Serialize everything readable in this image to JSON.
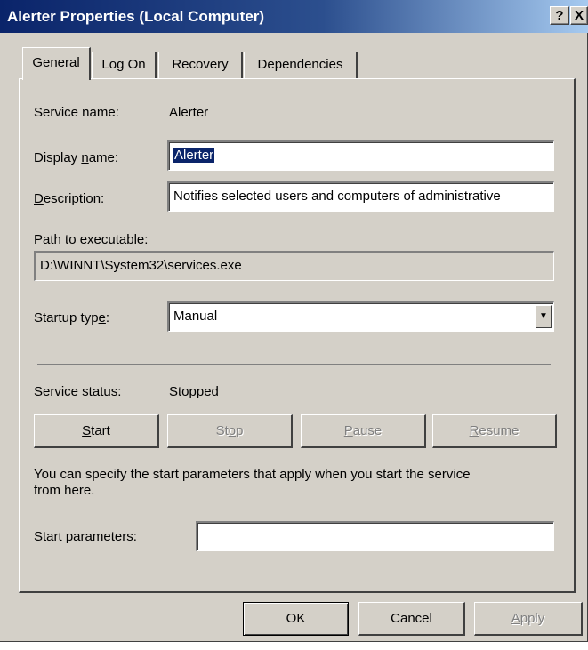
{
  "window": {
    "title": "Alerter Properties (Local Computer)",
    "help_label": "?",
    "close_label": "X"
  },
  "tabs": [
    {
      "label": "General",
      "active": true
    },
    {
      "label": "Log On",
      "active": false
    },
    {
      "label": "Recovery",
      "active": false
    },
    {
      "label": "Dependencies",
      "active": false
    }
  ],
  "general": {
    "service_name_label": "Service name:",
    "service_name_value": "Alerter",
    "display_name_label_pre": "Display ",
    "display_name_label_ul": "n",
    "display_name_label_post": "ame:",
    "display_name_value": "Alerter",
    "description_label_ul": "D",
    "description_label_post": "escription:",
    "description_value": "Notifies selected users and computers of administrative",
    "path_label_pre": "Pat",
    "path_label_ul": "h",
    "path_label_post": " to executable:",
    "path_value": "D:\\WINNT\\System32\\services.exe",
    "startup_label_pre": "Startup typ",
    "startup_label_ul": "e",
    "startup_label_post": ":",
    "startup_value": "Manual",
    "status_label": "Service status:",
    "status_value": "Stopped",
    "start_label_ul": "S",
    "start_label_post": "tart",
    "stop_label_pre": "St",
    "stop_label_ul": "o",
    "stop_label_post": "p",
    "pause_label_ul": "P",
    "pause_label_post": "ause",
    "resume_label_ul": "R",
    "resume_label_post": "esume",
    "hint_text_line1": "You can specify the start parameters that apply when you start the service",
    "hint_text_line2": "from here.",
    "start_params_label_pre": "Start para",
    "start_params_label_ul": "m",
    "start_params_label_post": "eters:",
    "start_params_value": ""
  },
  "footer": {
    "ok_label": "OK",
    "cancel_label": "Cancel",
    "apply_label_ul": "A",
    "apply_label_post": "pply"
  }
}
